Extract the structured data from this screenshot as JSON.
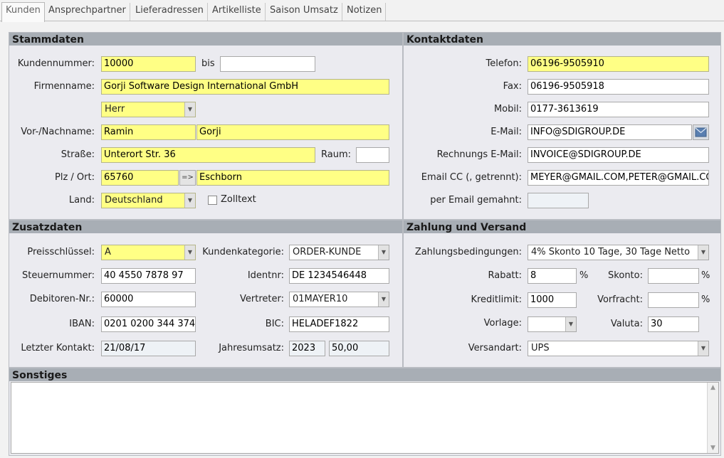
{
  "tabs": [
    "Kunden",
    "Ansprechpartner",
    "Lieferadressen",
    "Artikelliste",
    "Saison Umsatz",
    "Notizen"
  ],
  "stammdaten": {
    "title": "Stammdaten",
    "kundennummer_label": "Kundennummer:",
    "kundennummer": "10000",
    "bis_label": "bis",
    "bis": "",
    "firmenname_label": "Firmenname:",
    "firmenname": "Gorji Software Design International  GmbH",
    "anrede": "Herr",
    "name_label": "Vor-/Nachname:",
    "vorname": "Ramin",
    "nachname": "Gorji",
    "strasse_label": "Straße:",
    "strasse": "Unterort Str. 36",
    "raum_label": "Raum:",
    "raum": "",
    "plz_label": "Plz / Ort:",
    "plz": "65760",
    "plz_button": "=>",
    "ort": "Eschborn",
    "land_label": "Land:",
    "land": "Deutschland",
    "zolltext_label": "Zolltext"
  },
  "kontaktdaten": {
    "title": "Kontaktdaten",
    "telefon_label": "Telefon:",
    "telefon": "06196-9505910",
    "fax_label": "Fax:",
    "fax": "06196-9505918",
    "mobil_label": "Mobil:",
    "mobil": "0177-3613619",
    "email_label": "E-Mail:",
    "email": "INFO@SDIGROUP.DE",
    "rechnung_email_label": "Rechnungs E-Mail:",
    "rechnung_email": "INVOICE@SDIGROUP.DE",
    "email_cc_label": "Email CC (, getrennt):",
    "email_cc": "MEYER@GMAIL.COM,PETER@GMAIL.CO",
    "gemahnt_label": "per Email gemahnt:",
    "gemahnt": ""
  },
  "zusatzdaten": {
    "title": "Zusatzdaten",
    "preisschluessel_label": "Preisschlüssel:",
    "preisschluessel": "A",
    "kundenkategorie_label": "Kundenkategorie:",
    "kundenkategorie": "ORDER-KUNDE",
    "steuernummer_label": "Steuernummer:",
    "steuernummer": "40 4550 7878 97",
    "identnr_label": "Identnr:",
    "identnr": "DE 1234546448",
    "debitoren_label": "Debitoren-Nr.:",
    "debitoren": "60000",
    "vertreter_label": "Vertreter:",
    "vertreter": "01MAYER10",
    "iban_label": "IBAN:",
    "iban": "0201 0200 344 374",
    "bic_label": "BIC:",
    "bic": "HELADEF1822",
    "letzter_kontakt_label": "Letzter Kontakt:",
    "letzter_kontakt": "21/08/17",
    "jahresumsatz_label": "Jahresumsatz:",
    "jahresumsatz_jahr": "2023",
    "jahresumsatz_wert": "50,00"
  },
  "zahlung": {
    "title": "Zahlung und Versand",
    "zahlungsbedingungen_label": "Zahlungsbedingungen:",
    "zahlungsbedingungen": "4% Skonto 10 Tage, 30 Tage Netto",
    "rabatt_label": "Rabatt:",
    "rabatt": "8",
    "percent": "%",
    "skonto_label": "Skonto:",
    "skonto": "",
    "kreditlimit_label": "Kreditlimit:",
    "kreditlimit": "1000",
    "vorfracht_label": "Vorfracht:",
    "vorfracht": "",
    "vorlage_label": "Vorlage:",
    "vorlage": "",
    "valuta_label": "Valuta:",
    "valuta": "30",
    "versandart_label": "Versandart:",
    "versandart": "UPS"
  },
  "sonstiges": {
    "title": "Sonstiges",
    "text": ""
  }
}
